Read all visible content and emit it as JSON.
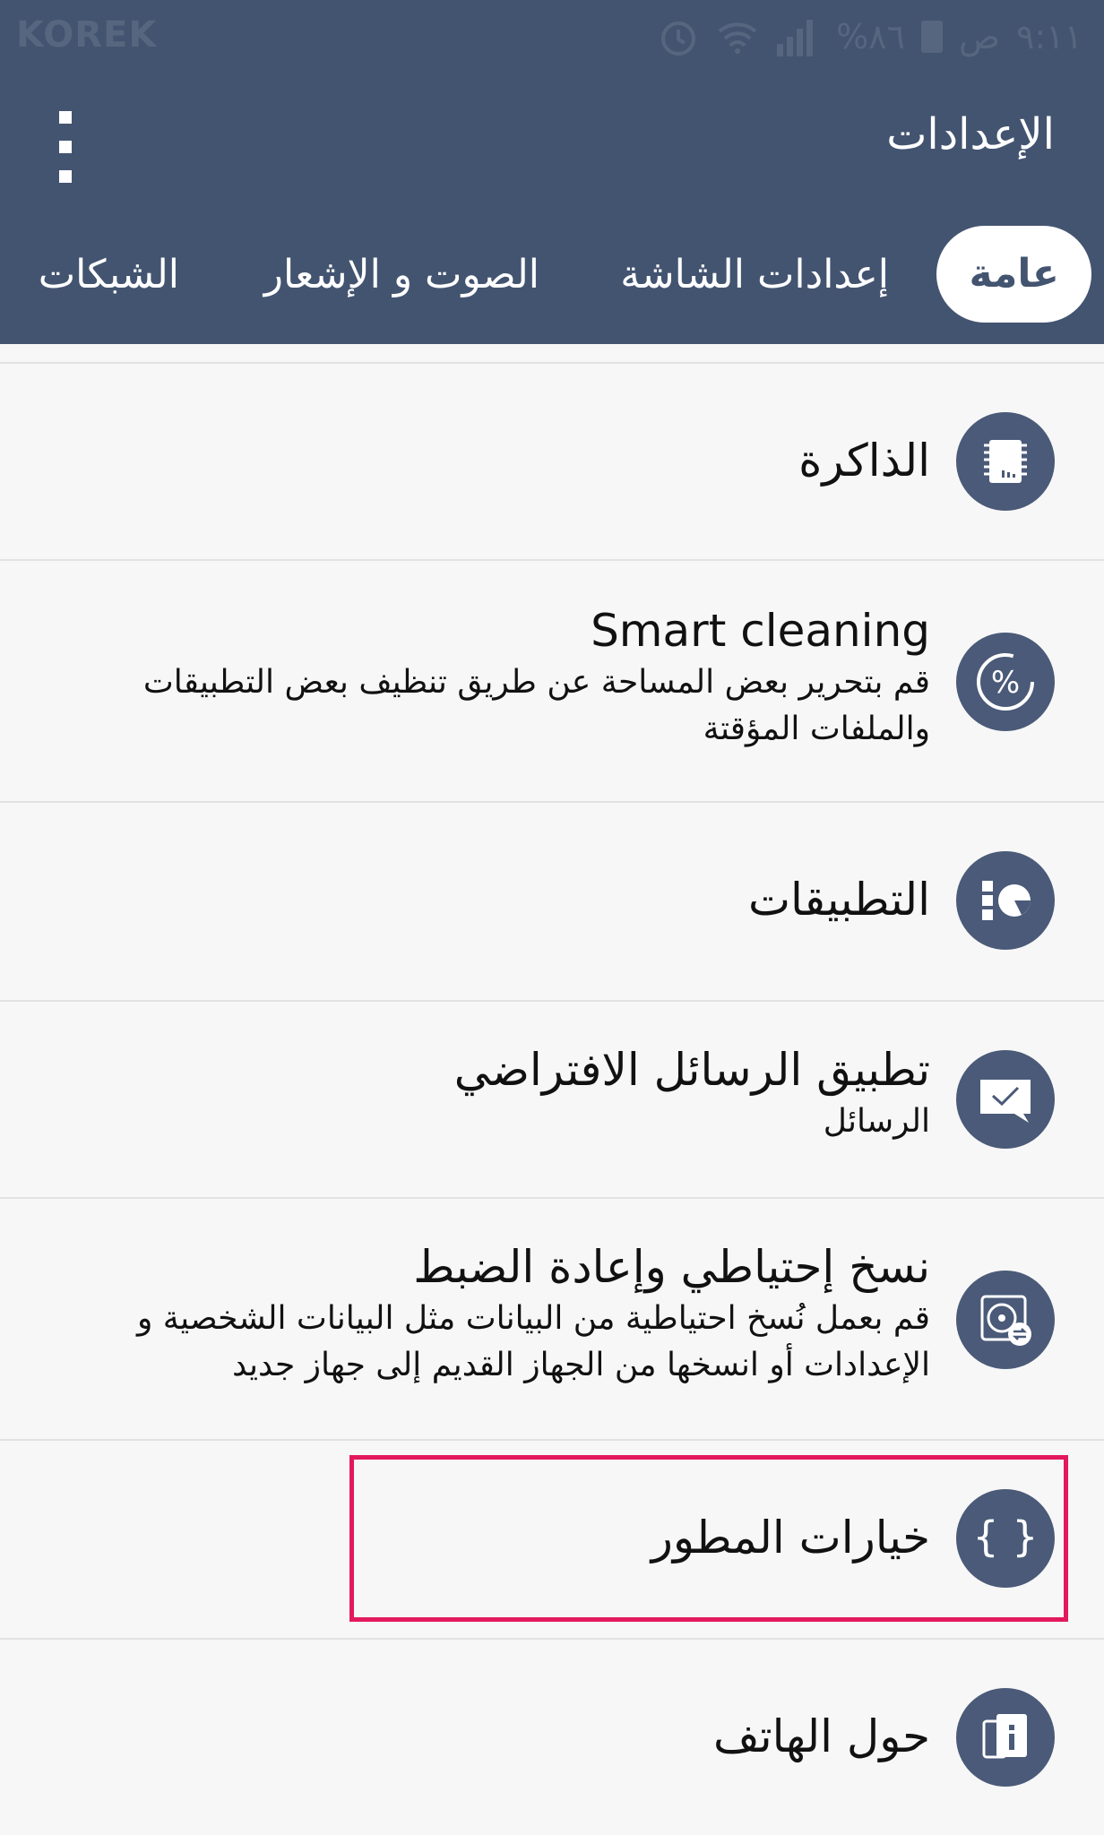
{
  "status_bar": {
    "carrier": "KOREK",
    "battery_percent": "%٨٦",
    "period": "ص",
    "time": "٩:١١"
  },
  "app_bar": {
    "title": "الإعدادات",
    "overflow_icon": "more-vert-icon"
  },
  "tabs": [
    {
      "label": "عامة",
      "active": true
    },
    {
      "label": "إعدادات الشاشة",
      "active": false
    },
    {
      "label": "الصوت و الإشعار",
      "active": false
    },
    {
      "label": "الشبكات",
      "active": false
    }
  ],
  "items": [
    {
      "title": "الذاكرة",
      "icon": "memory-chip-icon"
    },
    {
      "title": "Smart cleaning",
      "subtitle": "قم بتحرير بعض المساحة عن طريق تنظيف بعض التطبيقات والملفات المؤقتة",
      "icon": "percent-gauge-icon"
    },
    {
      "title": "التطبيقات",
      "icon": "apps-pie-icon"
    },
    {
      "title": "تطبيق الرسائل الافتراضي",
      "subtitle": "الرسائل",
      "icon": "message-check-icon"
    },
    {
      "title": "نسخ إحتياطي وإعادة الضبط",
      "subtitle": "قم بعمل نُسخ احتياطية من البيانات مثل البيانات الشخصية و الإعدادات أو انسخها من الجهاز القديم إلى جهاز جديد",
      "icon": "backup-disk-icon"
    },
    {
      "title": "خيارات المطور",
      "icon": "braces-icon"
    },
    {
      "title": "حول الهاتف",
      "icon": "phone-info-icon"
    }
  ],
  "colors": {
    "header": "#435470",
    "icon_badge": "#4a5a78",
    "highlight": "#e3195c"
  }
}
